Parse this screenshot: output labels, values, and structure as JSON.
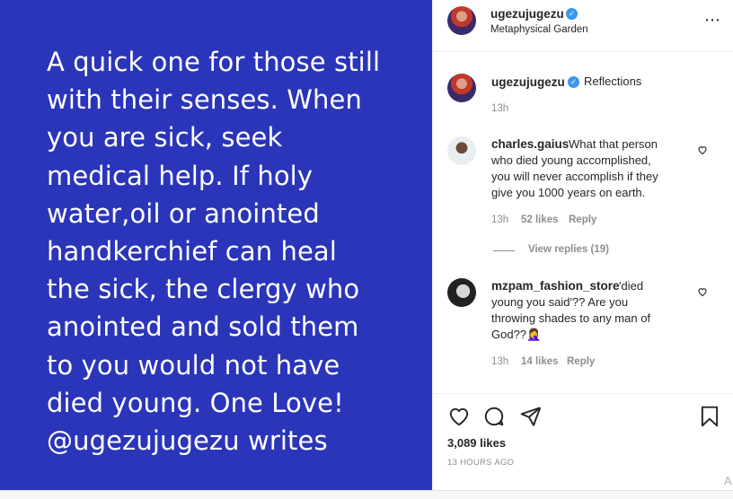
{
  "post": {
    "image_text": "A quick one for those still\nwith their senses. When\nyou are sick, seek\nmedical help. If holy\nwater,oil or anointed\nhandkerchief can heal\nthe sick, the clergy who\nanointed and sold them\nto you would not have\ndied young. One Love!\n@ugezujugezu writes",
    "background": "#2b35b9"
  },
  "header": {
    "username": "ugezujugezu",
    "location": "Metaphysical Garden",
    "more_icon": "⋯"
  },
  "caption": {
    "username": "ugezujugezu",
    "text": "Reflections",
    "time": "13h"
  },
  "comments": [
    {
      "username": "charles.gaius",
      "line1": "What that person",
      "line2": "who died young accomplished,",
      "line3": "you will never accomplish if they",
      "line4": "give you 1000 years on earth.",
      "time": "13h",
      "likes": "52 likes",
      "reply": "Reply",
      "view_replies": "View replies (19)"
    },
    {
      "username": "mzpam_fashion_store",
      "line1": "'died",
      "line2": "young you said'?? Are you",
      "line3": "throwing shades to any man of",
      "line4": "God??🤦‍♀️",
      "time": "13h",
      "likes": "14 likes",
      "reply": "Reply"
    }
  ],
  "actions": {
    "likes": "3,089 likes",
    "time": "13 HOURS AGO"
  },
  "icons": {
    "like": "heart-icon",
    "comment": "comment-icon",
    "share": "share-icon",
    "save": "bookmark-icon"
  },
  "colors": {
    "verified": "#3897f0",
    "meta_gray": "#8e8e8e"
  },
  "corner_letter": "A"
}
